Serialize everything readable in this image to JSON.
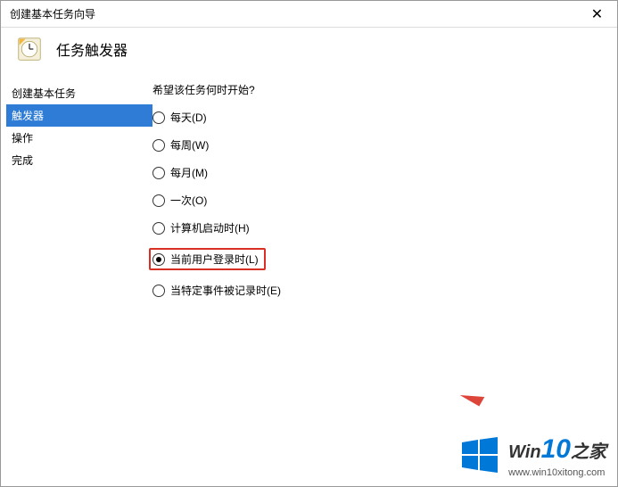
{
  "window": {
    "title": "创建基本任务向导"
  },
  "header": {
    "title": "任务触发器"
  },
  "sidebar": {
    "items": [
      {
        "label": "创建基本任务",
        "selected": false
      },
      {
        "label": "触发器",
        "selected": true
      },
      {
        "label": "操作",
        "selected": false
      },
      {
        "label": "完成",
        "selected": false
      }
    ]
  },
  "main": {
    "prompt": "希望该任务何时开始?",
    "options": [
      {
        "label": "每天(D)",
        "checked": false
      },
      {
        "label": "每周(W)",
        "checked": false
      },
      {
        "label": "每月(M)",
        "checked": false
      },
      {
        "label": "一次(O)",
        "checked": false
      },
      {
        "label": "计算机启动时(H)",
        "checked": false
      },
      {
        "label": "当前用户登录时(L)",
        "checked": true,
        "highlighted": true
      },
      {
        "label": "当特定事件被记录时(E)",
        "checked": false
      }
    ]
  },
  "watermark": {
    "brand_prefix": "Win",
    "brand_num": "10",
    "brand_suffix": "之家",
    "url": "www.win10xitong.com"
  }
}
